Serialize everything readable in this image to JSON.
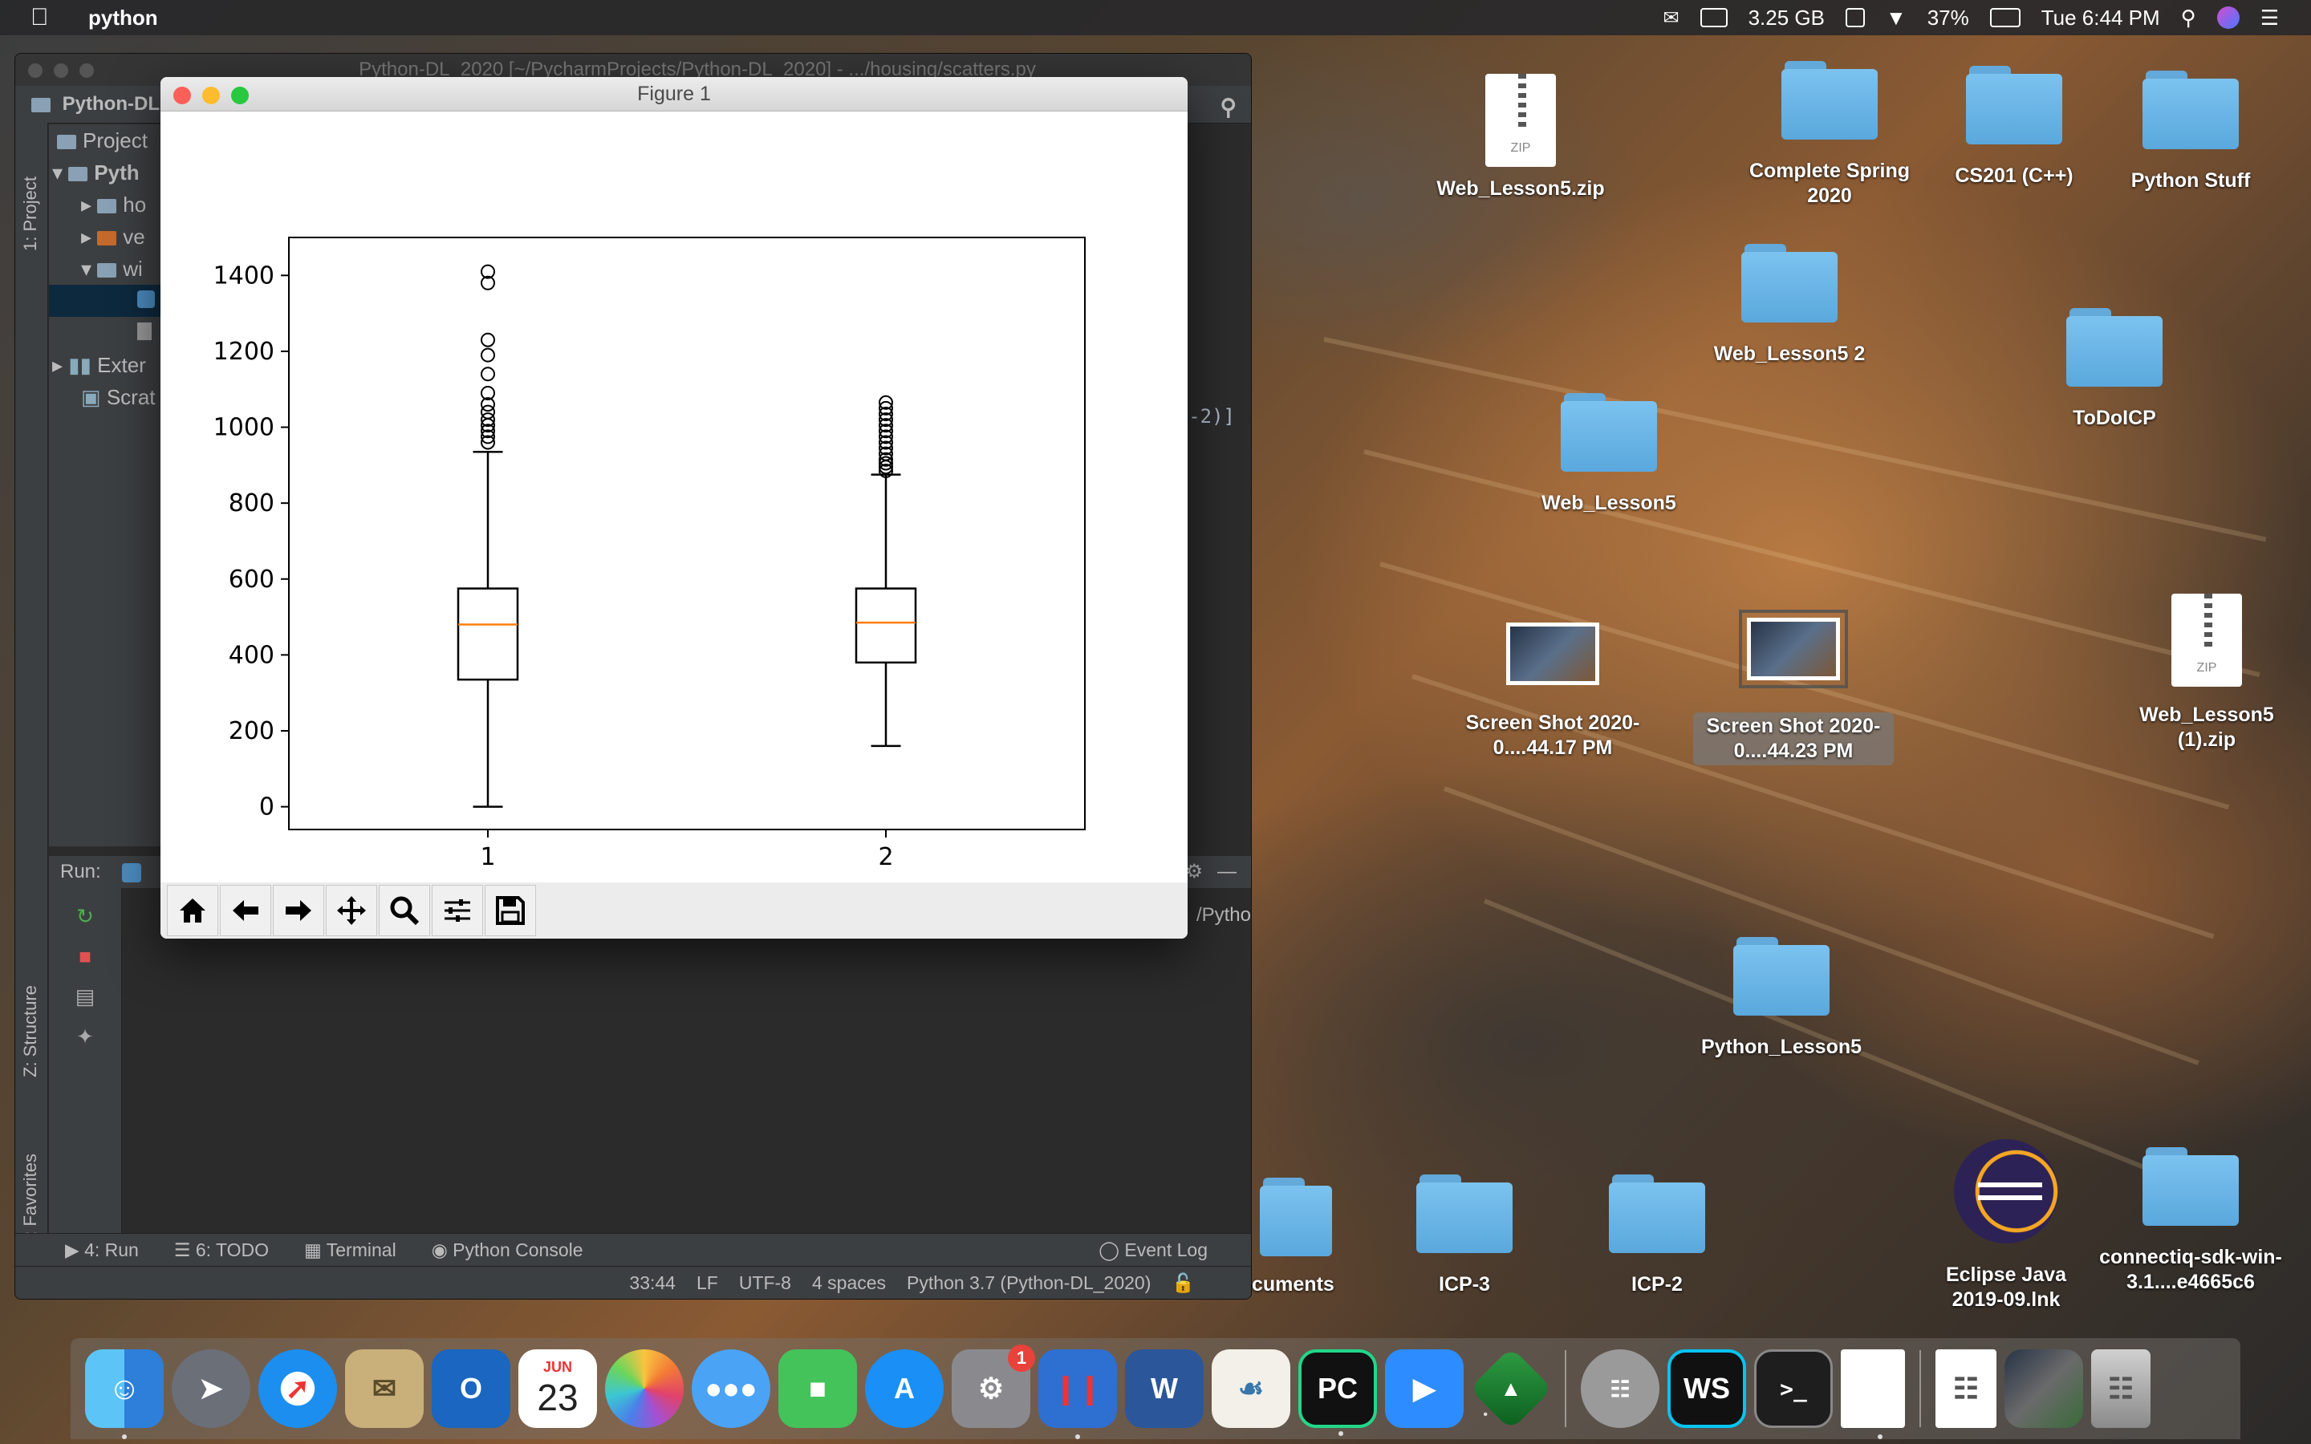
{
  "menubar": {
    "app_name": "python",
    "memory": "3.25 GB",
    "battery": "37%",
    "clock": "Tue 6:44 PM"
  },
  "ide": {
    "window_title": "Python-DL_2020 [~/PycharmProjects/Python-DL_2020] - .../housing/scatters.py",
    "nav_project": "Python-DL",
    "left_tab_project": "1: Project",
    "left_tab_structure": "Z: Structure",
    "left_tab_favorites": "2: Favorites",
    "project_header": "Project",
    "tree": [
      "Pyth",
      "ho",
      "ve",
      "wi",
      "Exter",
      "Scrat"
    ],
    "editor_snippet": "-2)]",
    "run_label": "Run:",
    "run_output": "/Pytho",
    "bottom_tabs": {
      "run": "4: Run",
      "todo": "6: TODO",
      "terminal": "Terminal",
      "console": "Python Console",
      "event_log": "Event Log"
    },
    "status": {
      "position": "33:44",
      "line_sep": "LF",
      "encoding": "UTF-8",
      "indent": "4 spaces",
      "interpreter": "Python 3.7 (Python-DL_2020)"
    }
  },
  "figure": {
    "title": "Figure 1",
    "toolbar_icons": [
      "home-icon",
      "back-icon",
      "forward-icon",
      "pan-icon",
      "zoom-icon",
      "configure-icon",
      "save-icon"
    ]
  },
  "chart_data": {
    "type": "box",
    "title": "",
    "xlabel": "",
    "ylabel": "",
    "categories": [
      "1",
      "2"
    ],
    "ylim": [
      -60,
      1500
    ],
    "yticks": [
      0,
      200,
      400,
      600,
      800,
      1000,
      1200,
      1400
    ],
    "boxes": [
      {
        "label": "1",
        "whisker_low": 0,
        "q1": 335,
        "median": 480,
        "q3": 575,
        "whisker_high": 935,
        "outliers": [
          960,
          975,
          990,
          1005,
          1020,
          1040,
          1060,
          1090,
          1140,
          1190,
          1230,
          1380,
          1410
        ]
      },
      {
        "label": "2",
        "whisker_low": 160,
        "q1": 380,
        "median": 485,
        "q3": 575,
        "whisker_high": 875,
        "outliers": [
          885,
          895,
          905,
          915,
          930,
          945,
          960,
          975,
          990,
          1005,
          1020,
          1035,
          1050,
          1065
        ]
      }
    ],
    "median_color": "#ff7f0e",
    "grid": false
  },
  "desktop": {
    "icons": [
      {
        "label": "Web_Lesson5.zip",
        "type": "zip"
      },
      {
        "label": "Complete Spring 2020",
        "type": "folder"
      },
      {
        "label": "CS201 (C++)",
        "type": "folder"
      },
      {
        "label": "Python Stuff",
        "type": "folder"
      },
      {
        "label": "Web_Lesson5 2",
        "type": "folder"
      },
      {
        "label": "ToDoICP",
        "type": "folder"
      },
      {
        "label": "Web_Lesson5",
        "type": "folder"
      },
      {
        "label": "Screen Shot 2020-0....44.17 PM",
        "type": "screenshot"
      },
      {
        "label": "Screen Shot 2020-0....44.23 PM",
        "type": "screenshot"
      },
      {
        "label": "Web_Lesson5 (1).zip",
        "type": "zip"
      },
      {
        "label": "Python_Lesson5",
        "type": "folder"
      },
      {
        "label": "cuments",
        "type": "folder"
      },
      {
        "label": "ICP-3",
        "type": "folder"
      },
      {
        "label": "ICP-2",
        "type": "folder"
      },
      {
        "label": "Eclipse Java 2019-09.lnk",
        "type": "app"
      },
      {
        "label": "connectiq-sdk-win-3.1....e4665c6",
        "type": "folder"
      }
    ]
  },
  "dock": {
    "calendar_month": "JUN",
    "calendar_day": "23",
    "prefs_badge": "1",
    "word_letter": "W",
    "outlook_letter": "O",
    "pycharm_letters": "PC",
    "webstorm_letters": "WS",
    "terminal_prompt": ">_"
  }
}
